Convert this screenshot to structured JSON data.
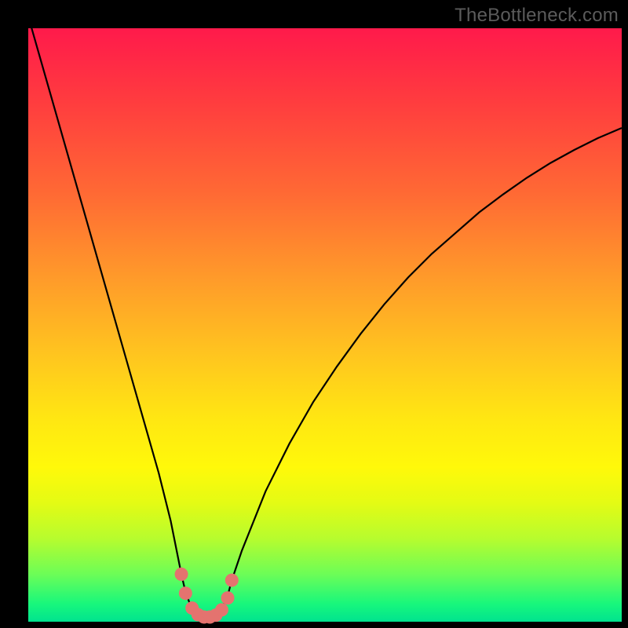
{
  "watermark": "TheBottleneck.com",
  "colors": {
    "curve_stroke": "#000000",
    "marker_fill": "#e4736f",
    "marker_stroke": "#e4736f",
    "frame_bg": "#000000"
  },
  "chart_data": {
    "type": "line",
    "title": "",
    "xlabel": "",
    "ylabel": "",
    "xlim": [
      0,
      100
    ],
    "ylim": [
      0,
      100
    ],
    "grid": false,
    "x": [
      0,
      2,
      4,
      6,
      8,
      10,
      12,
      14,
      16,
      18,
      20,
      22,
      24,
      25.8,
      26.5,
      27.5,
      28.5,
      29.5,
      30.5,
      31.5,
      32.5,
      33.5,
      34.3,
      36,
      38,
      40,
      44,
      48,
      52,
      56,
      60,
      64,
      68,
      72,
      76,
      80,
      84,
      88,
      92,
      96,
      100
    ],
    "y": [
      102,
      95,
      88,
      81,
      74,
      67,
      60,
      53,
      46,
      39,
      32,
      25,
      17,
      8,
      5,
      2.3,
      1.2,
      0.8,
      0.8,
      1.1,
      2.0,
      4.0,
      7.0,
      12,
      17,
      22,
      30,
      37,
      43,
      48.5,
      53.5,
      58,
      62,
      65.5,
      69,
      72,
      74.8,
      77.3,
      79.5,
      81.5,
      83.2
    ],
    "markers": {
      "x": [
        25.8,
        26.5,
        27.6,
        28.6,
        29.6,
        30.6,
        31.6,
        32.6,
        33.6,
        34.3
      ],
      "y": [
        8.0,
        4.8,
        2.3,
        1.2,
        0.8,
        0.8,
        1.1,
        2.0,
        4.0,
        7.0
      ],
      "radius": 8
    }
  }
}
